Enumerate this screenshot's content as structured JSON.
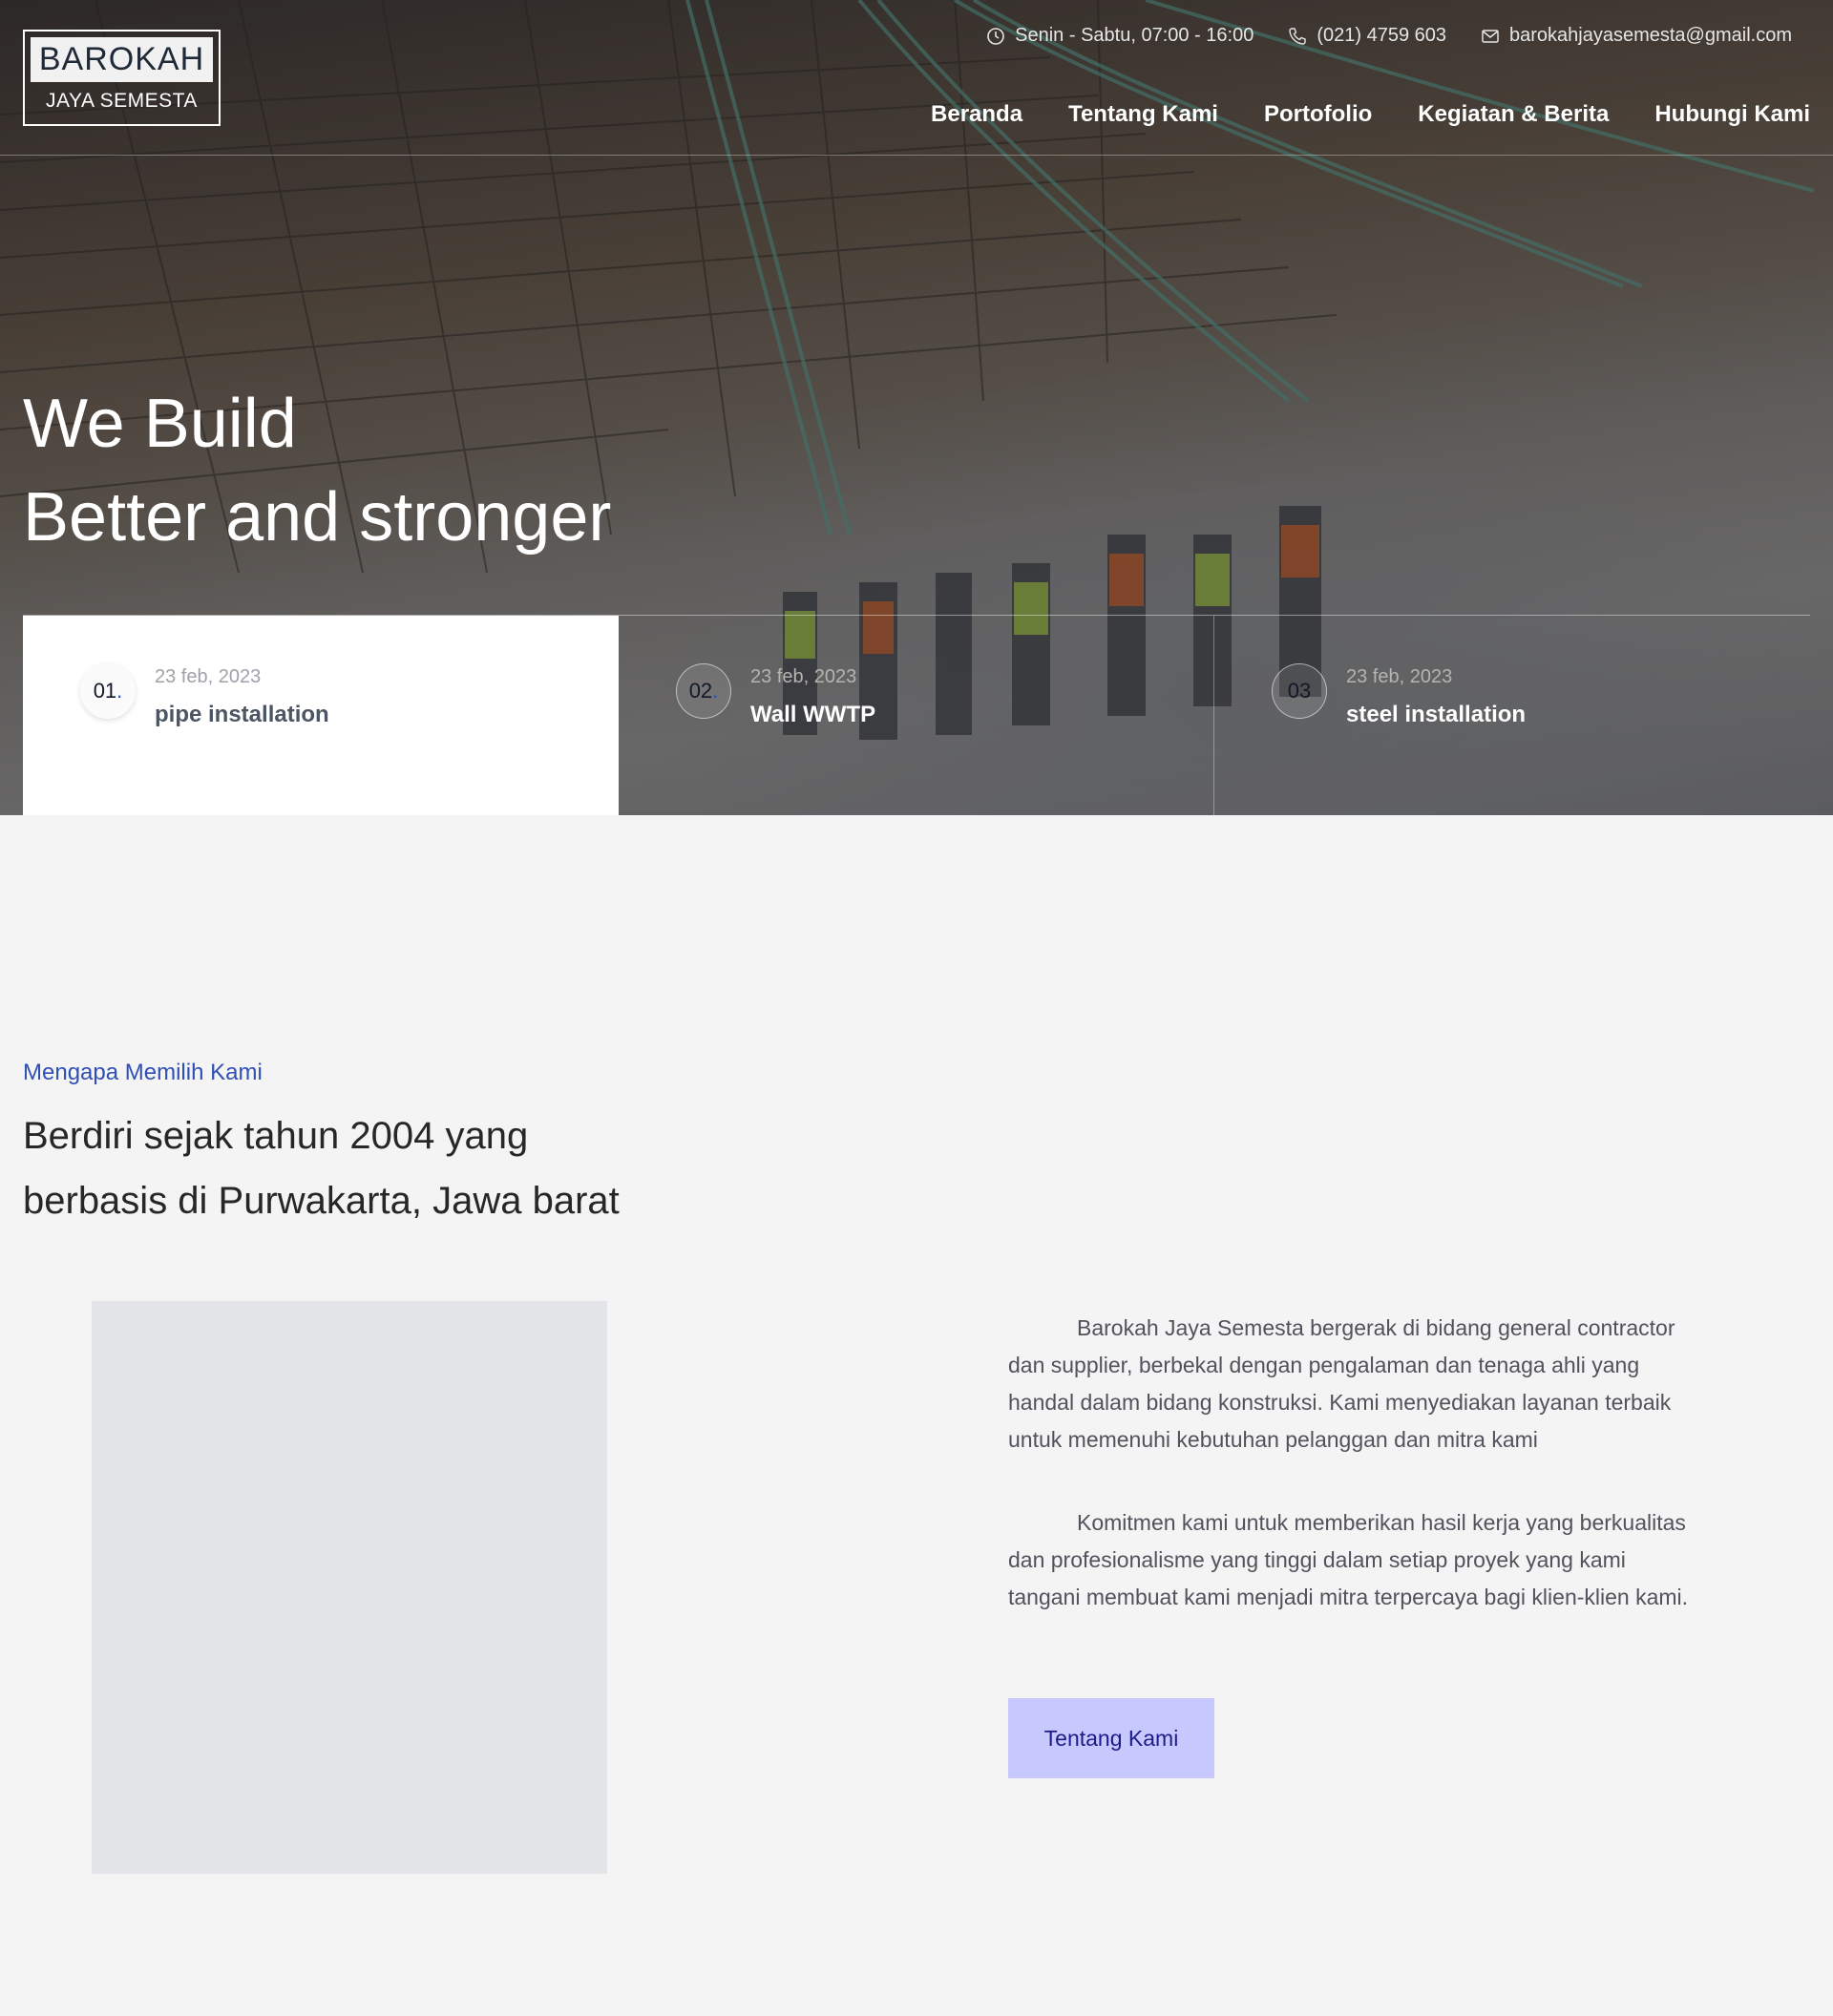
{
  "brand": {
    "name_top": "BAROKAH",
    "name_bottom": "JAYA SEMESTA"
  },
  "topbar": {
    "hours": "Senin - Sabtu, 07:00 - 16:00",
    "phone": "(021) 4759 603",
    "email": "barokahjayasemesta@gmail.com"
  },
  "nav": {
    "items": [
      "Beranda",
      "Tentang Kami",
      "Portofolio",
      "Kegiatan & Berita",
      "Hubungi Kami"
    ]
  },
  "hero": {
    "line1": "We Build",
    "line2": "Better and stronger"
  },
  "cards": [
    {
      "num": "01",
      "date": "23 feb, 2023",
      "title": "pipe installation"
    },
    {
      "num": "02",
      "date": "23 feb, 2023",
      "title": "Wall WWTP"
    },
    {
      "num": "03",
      "date": "23 feb, 2023",
      "title": "steel installation"
    }
  ],
  "about": {
    "eyebrow": "Mengapa Memilih Kami",
    "title_line1": "Berdiri sejak tahun 2004 yang",
    "title_line2": "berbasis di Purwakarta, Jawa barat",
    "para1": "Barokah Jaya Semesta bergerak di bidang general contractor dan supplier, berbekal dengan pengalaman dan tenaga ahli yang handal dalam bidang konstruksi. Kami menyediakan layanan terbaik untuk memenuhi kebutuhan pelanggan dan mitra kami",
    "para2": "Komitmen kami untuk memberikan hasil kerja yang berkualitas dan profesionalisme yang tinggi dalam setiap proyek yang kami tangani membuat kami menjadi mitra terpercaya bagi klien-klien kami.",
    "button": "Tentang Kami"
  },
  "colors": {
    "accent": "#2f4fb3",
    "button_bg": "#c7c8fd",
    "button_text": "#1e1b8a",
    "page_bg": "#f4f4f5"
  }
}
